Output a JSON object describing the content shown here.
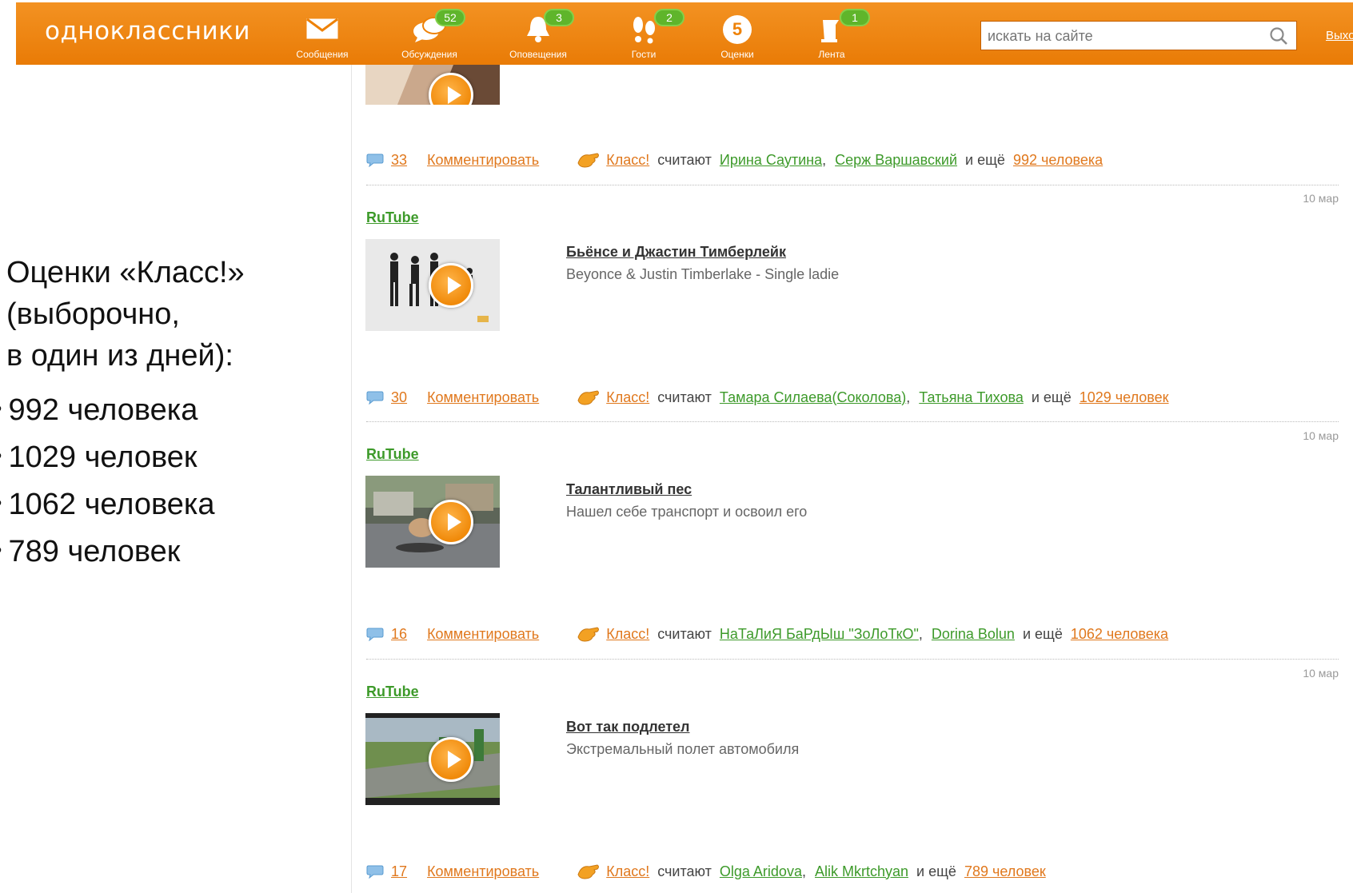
{
  "header": {
    "logo": "одноклассники",
    "nav": [
      {
        "label": "Сообщения",
        "icon": "envelope-icon",
        "badge": ""
      },
      {
        "label": "Обсуждения",
        "icon": "chat-bubbles-icon",
        "badge": "52"
      },
      {
        "label": "Оповещения",
        "icon": "bell-icon",
        "badge": "3"
      },
      {
        "label": "Гости",
        "icon": "footprints-icon",
        "badge": "2"
      },
      {
        "label": "Оценки",
        "icon": "rating-five-icon",
        "badge": "",
        "value": "5"
      },
      {
        "label": "Лента",
        "icon": "feed-flag-icon",
        "badge": "1"
      }
    ],
    "search_placeholder": "искать на сайте",
    "logout": "Выход"
  },
  "caption": {
    "lines": [
      "Оценки «Класс!»",
      "(выборочно,",
      "в один из дней):"
    ],
    "stats": [
      "992 человека",
      "1029 человек",
      "1062 человека",
      "789 человек"
    ]
  },
  "feed": {
    "comment_label": "Комментировать",
    "klass_label": "Класс!",
    "considers": "считают",
    "and_more": "и ещё",
    "posts": [
      {
        "source": "",
        "date": "",
        "title": "",
        "description": "",
        "comments": "33",
        "liker1": "Ирина Саутина",
        "liker2": "Серж Варшавский",
        "more": "992 человека"
      },
      {
        "source": "RuTube",
        "date": "10 мар",
        "title": "Бьёнсе и Джастин Тимберлейк",
        "description": "Beyonce & Justin Timberlake - Single ladie",
        "comments": "30",
        "liker1": "Тамара Силаева(Соколова)",
        "liker2": "Татьяна Тихова",
        "more": "1029 человек"
      },
      {
        "source": "RuTube",
        "date": "10 мар",
        "title": "Талантливый пес",
        "description": "Нашел себе транспорт и освоил его",
        "comments": "16",
        "liker1": "НаТаЛиЯ БаРдЫш \"ЗоЛоТкО\"",
        "liker2": "Dorina Bolun",
        "more": "1062 человека"
      },
      {
        "source": "RuTube",
        "date": "10 мар",
        "title": "Вот так подлетел",
        "description": "Экстремальный полет автомобиля",
        "comments": "17",
        "liker1": "Olga Aridova",
        "liker2": "Alik Mkrtchyan",
        "more": "789 человек"
      }
    ]
  },
  "colors": {
    "brand_orange": "#ee8208",
    "badge_green": "#5fb52b",
    "link_green": "#3d9a2a",
    "link_orange": "#e0781d"
  }
}
